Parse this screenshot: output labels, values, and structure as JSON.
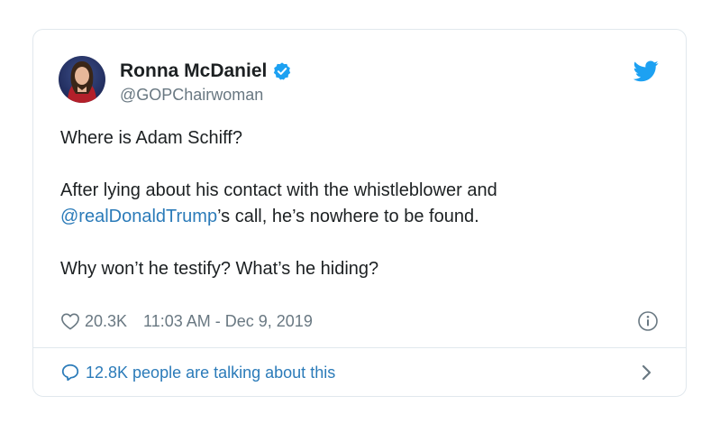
{
  "author": {
    "name": "Ronna McDaniel",
    "handle": "@GOPChairwoman",
    "verified": true
  },
  "tweet": {
    "line1": "Where is Adam Schiff?",
    "line2_part1": "After lying about his contact with the whistleblower and",
    "mention": "@realDonaldTrump",
    "line2_part2": "’s call, he’s nowhere to be found.",
    "line3": "Why won’t he testify? What’s he hiding?"
  },
  "meta": {
    "likes": "20.3K",
    "timestamp": "11:03 AM - Dec 9, 2019"
  },
  "footer": {
    "talking": "12.8K people are talking about this"
  },
  "colors": {
    "link": "#2b7bb9",
    "twitter_blue": "#1da1f2",
    "muted": "#697882",
    "border": "#e1e8ed"
  },
  "icons": [
    "avatar",
    "verified-badge-icon",
    "twitter-bird-icon",
    "heart-icon",
    "info-icon",
    "speech-bubble-icon",
    "chevron-right-icon"
  ]
}
